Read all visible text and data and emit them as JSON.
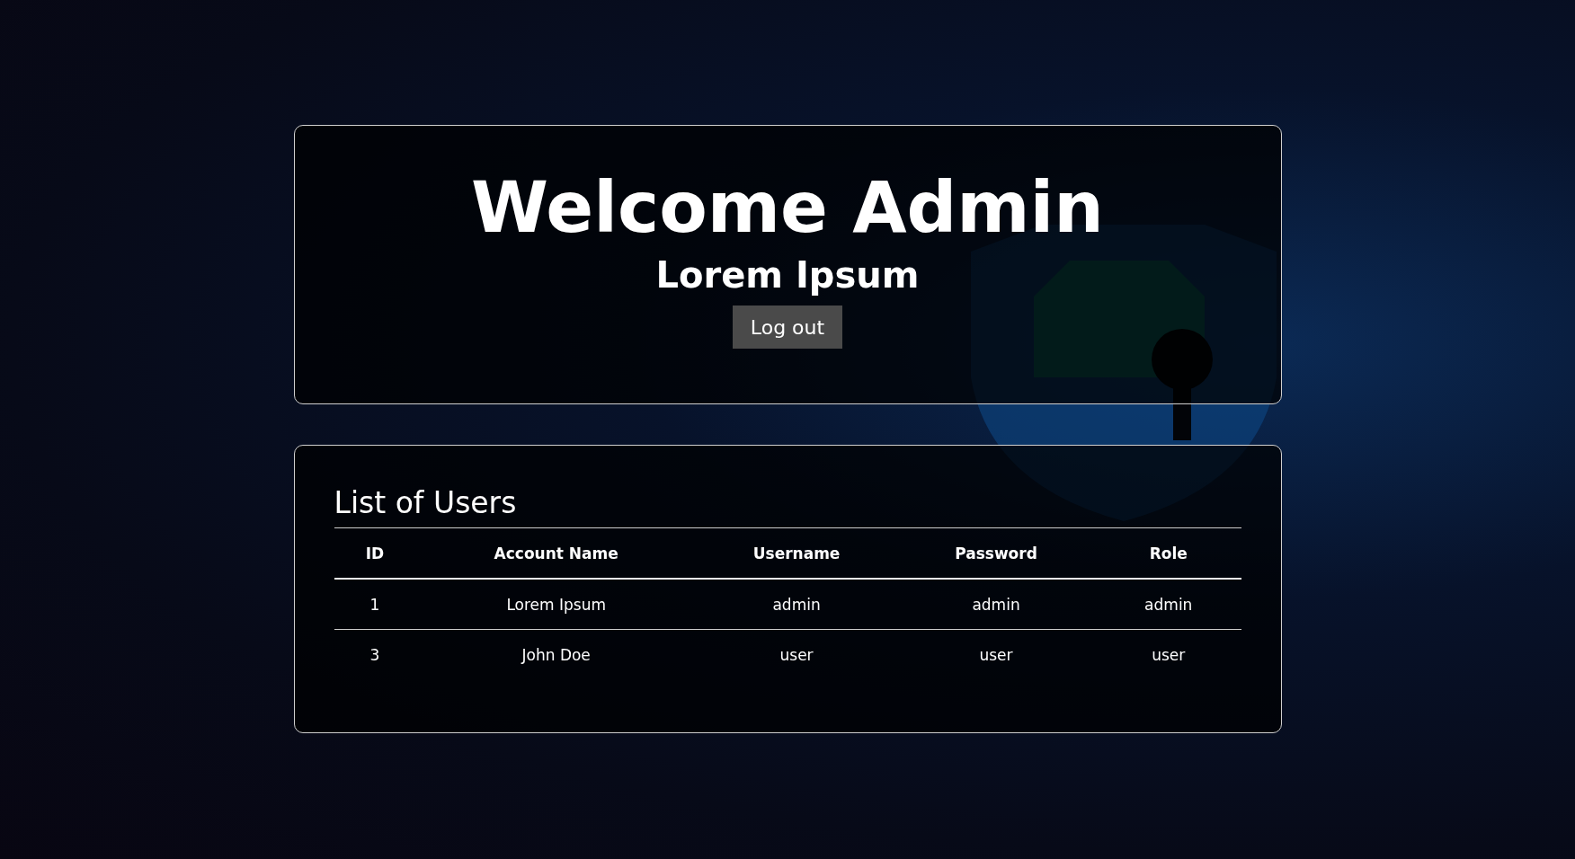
{
  "header": {
    "title": "Welcome Admin",
    "subtitle": "Lorem Ipsum",
    "logout_button": "Log out"
  },
  "users": {
    "title": "List of Users",
    "columns": [
      "ID",
      "Account Name",
      "Username",
      "Password",
      "Role"
    ],
    "rows": [
      [
        "1",
        "Lorem Ipsum",
        "admin",
        "admin",
        "admin"
      ],
      [
        "3",
        "John Doe",
        "user",
        "user",
        "user"
      ]
    ]
  }
}
